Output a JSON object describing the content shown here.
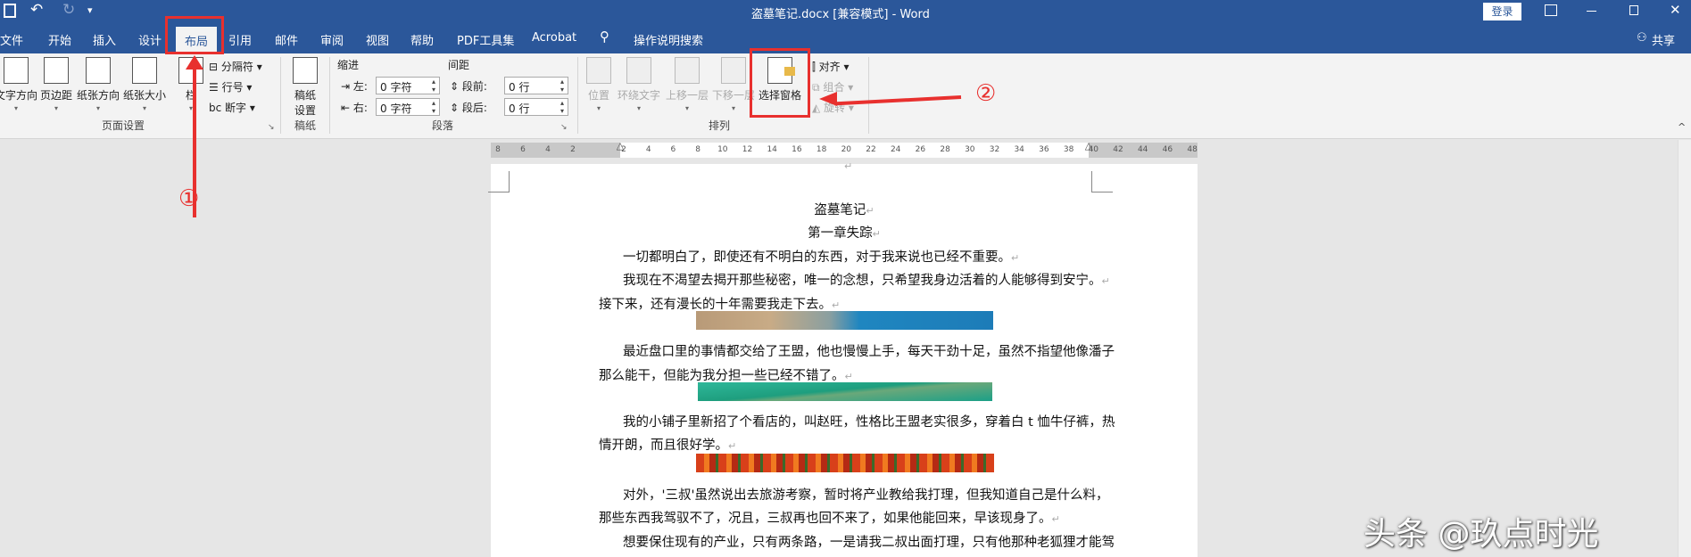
{
  "titlebar": {
    "title": "盗墓笔记.docx [兼容模式] - Word",
    "login": "登录",
    "qat_more": "▾"
  },
  "tabs": [
    "文件",
    "开始",
    "插入",
    "设计",
    "布局",
    "引用",
    "邮件",
    "审阅",
    "视图",
    "帮助",
    "PDF工具集",
    "Acrobat"
  ],
  "tell_me": "操作说明搜索",
  "share": "共享",
  "ribbon": {
    "page_setup": {
      "label": "页面设置",
      "text_direction": "文字方向",
      "margins": "页边距",
      "orientation": "纸张方向",
      "size": "纸张大小",
      "columns": "栏",
      "breaks": "分隔符",
      "line_numbers": "行号",
      "hyphenation": "断字"
    },
    "manuscript": {
      "label": "稿纸",
      "settings": "稿纸\n设置",
      "btn1": "稿纸",
      "btn2": "设置"
    },
    "paragraph": {
      "label": "段落",
      "indent": "缩进",
      "spacing": "间距",
      "left": "左:",
      "right": "右:",
      "before": "段前:",
      "after": "段后:",
      "left_value": "0 字符",
      "right_value": "0 字符",
      "before_value": "0 行",
      "after_value": "0 行"
    },
    "arrange": {
      "label": "排列",
      "position": "位置",
      "wrap": "环绕文字",
      "forward": "上移一层",
      "backward": "下移一层",
      "selection_pane": "选择窗格",
      "align": "对齐",
      "group": "组合",
      "rotate": "旋转"
    }
  },
  "ruler": [
    "8",
    "6",
    "4",
    "2",
    "2",
    "4",
    "6",
    "8",
    "10",
    "12",
    "14",
    "16",
    "18",
    "20",
    "22",
    "24",
    "26",
    "28",
    "30",
    "32",
    "34",
    "36",
    "38",
    "40",
    "42",
    "44",
    "46",
    "48"
  ],
  "document": {
    "title": "盗墓笔记",
    "chapter": "第一章失踪",
    "lines": [
      "一切都明白了，即使还有不明白的东西，对于我来说也已经不重要。",
      "我现在不渴望去揭开那些秘密，唯一的念想，只希望我身边活着的人能够得到安宁。",
      "接下来，还有漫长的十年需要我走下去。",
      "最近盘口里的事情都交给了王盟，他也慢慢上手，每天干劲十足，虽然不指望他像潘子",
      "那么能干，但能为我分担一些已经不错了。",
      "我的小铺子里新招了个看店的，叫赵旺，性格比王盟老实很多，穿着白 t 恤牛仔裤，热",
      "情开朗，而且很好学。",
      "对外，'三叔'虽然说出去旅游考察，暂时将产业教给我打理，但我知道自己是什么料，",
      "那些东西我驾驭不了，况且，三叔再也回不来了，如果他能回来，早该现身了。",
      "想要保住现有的产业，只有两条路，一是请我二叔出面打理，只有他那种老狐狸才能驾"
    ],
    "paragraph_mark": "↵"
  },
  "annotations": {
    "step1": "①",
    "step2": "②"
  },
  "watermark": "头条 @玖点时光",
  "colors": {
    "brand": "#2b579a",
    "annotation": "#e8302e"
  }
}
